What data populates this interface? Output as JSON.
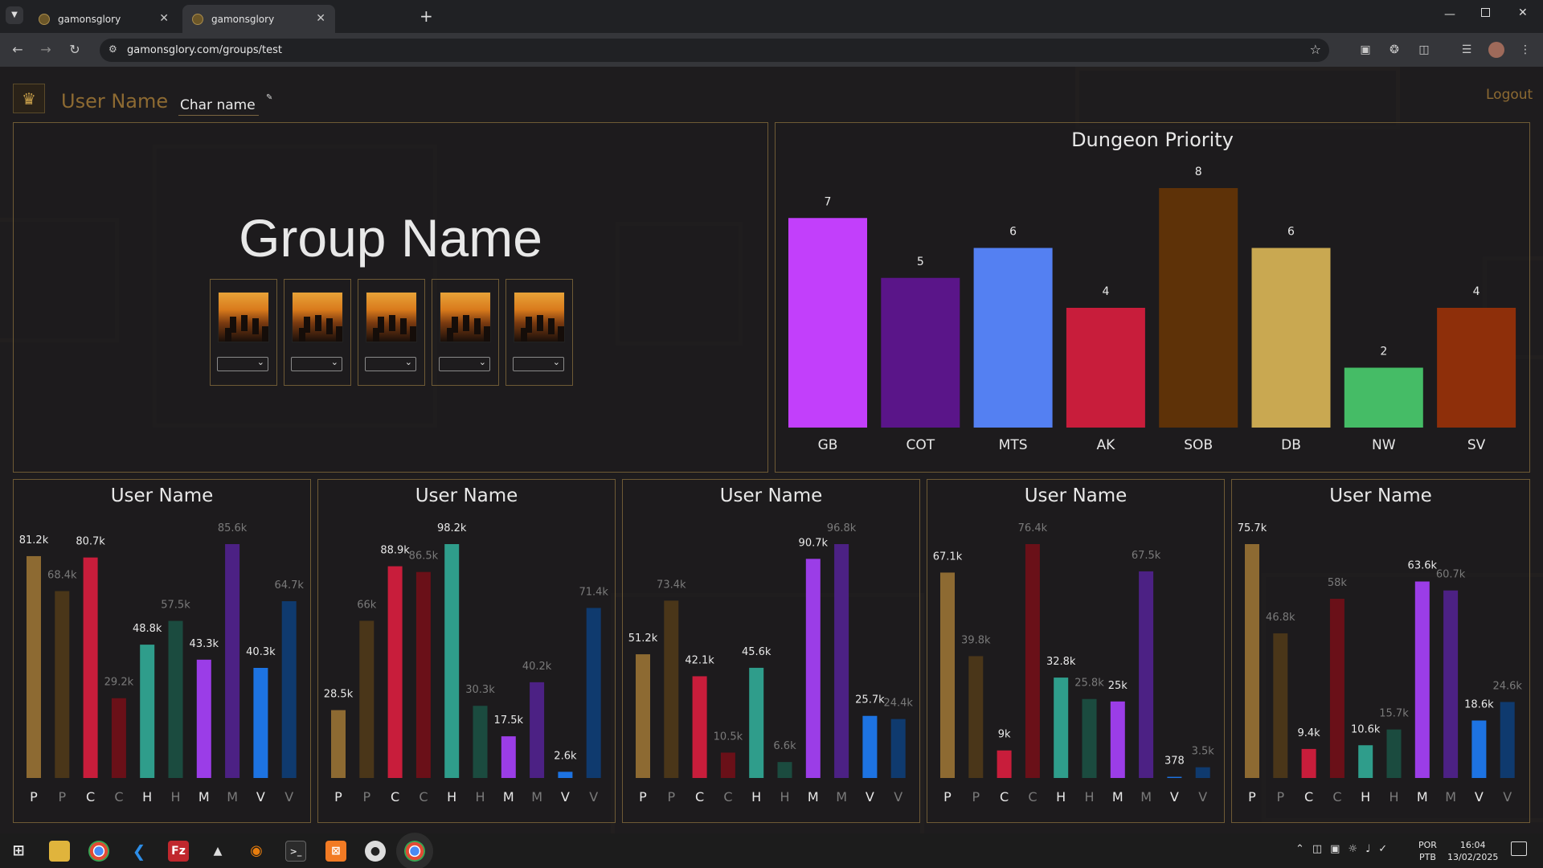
{
  "browser": {
    "tabs": [
      {
        "title": "gamonsglory"
      },
      {
        "title": "gamonsglory"
      }
    ],
    "new_tab_icon": "plus-icon",
    "url": "gamonsglory.com/groups/test"
  },
  "header": {
    "user_name": "User Name",
    "char_name": "Char name",
    "logout": "Logout"
  },
  "group": {
    "name": "Group Name",
    "member_count": 5
  },
  "chart_data": [
    {
      "type": "bar",
      "title": "Dungeon Priority",
      "categories": [
        "GB",
        "COT",
        "MTS",
        "AK",
        "SOB",
        "DB",
        "NW",
        "SV"
      ],
      "values": [
        7,
        5,
        6,
        4,
        8,
        6,
        2,
        4
      ],
      "colors": [
        "#c23ffb",
        "#5a1589",
        "#5480f2",
        "#c81d3b",
        "#5e3208",
        "#c9a851",
        "#45bc66",
        "#8e2f0a"
      ],
      "ylim": [
        0,
        8
      ]
    },
    {
      "type": "bar",
      "title": "User Name",
      "categories": [
        "P",
        "P",
        "C",
        "C",
        "H",
        "H",
        "M",
        "M",
        "V",
        "V"
      ],
      "values": [
        "81.2k",
        "68.4k",
        "80.7k",
        "29.2k",
        "48.8k",
        "57.5k",
        "43.3k",
        "85.6k",
        "40.3k",
        "64.7k"
      ]
    },
    {
      "type": "bar",
      "title": "User Name",
      "categories": [
        "P",
        "P",
        "C",
        "C",
        "H",
        "H",
        "M",
        "M",
        "V",
        "V"
      ],
      "values": [
        "28.5k",
        "66k",
        "88.9k",
        "86.5k",
        "98.2k",
        "30.3k",
        "17.5k",
        "40.2k",
        "2.6k",
        "71.4k"
      ]
    },
    {
      "type": "bar",
      "title": "User Name",
      "categories": [
        "P",
        "P",
        "C",
        "C",
        "H",
        "H",
        "M",
        "M",
        "V",
        "V"
      ],
      "values": [
        "51.2k",
        "73.4k",
        "42.1k",
        "10.5k",
        "45.6k",
        "6.6k",
        "90.7k",
        "96.8k",
        "25.7k",
        "24.4k"
      ]
    },
    {
      "type": "bar",
      "title": "User Name",
      "categories": [
        "P",
        "P",
        "C",
        "C",
        "H",
        "H",
        "M",
        "M",
        "V",
        "V"
      ],
      "values": [
        "67.1k",
        "39.8k",
        "9k",
        "76.4k",
        "32.8k",
        "25.8k",
        "25k",
        "67.5k",
        "378",
        "3.5k"
      ]
    },
    {
      "type": "bar",
      "title": "User Name",
      "categories": [
        "P",
        "P",
        "C",
        "C",
        "H",
        "H",
        "M",
        "M",
        "V",
        "V"
      ],
      "values": [
        "75.7k",
        "46.8k",
        "9.4k",
        "58k",
        "10.6k",
        "15.7k",
        "63.6k",
        "60.7k",
        "18.6k",
        "24.6k"
      ]
    }
  ],
  "player_bar_colors": [
    "#8d6a32",
    "#4a3619",
    "#c81d3b",
    "#6a1018",
    "#2f9d8b",
    "#1b4b3f",
    "#9b3de7",
    "#4c2184",
    "#1d73e2",
    "#0f3a6e"
  ],
  "player_label_colors": [
    "#e8e8e8",
    "#7a7a7a",
    "#e8e8e8",
    "#7a7a7a",
    "#e8e8e8",
    "#7a7a7a",
    "#e8e8e8",
    "#7a7a7a",
    "#e8e8e8",
    "#7a7a7a"
  ],
  "taskbar": {
    "lang": "POR",
    "kbd": "PTB",
    "time": "16:04",
    "date": "13/02/2025"
  }
}
